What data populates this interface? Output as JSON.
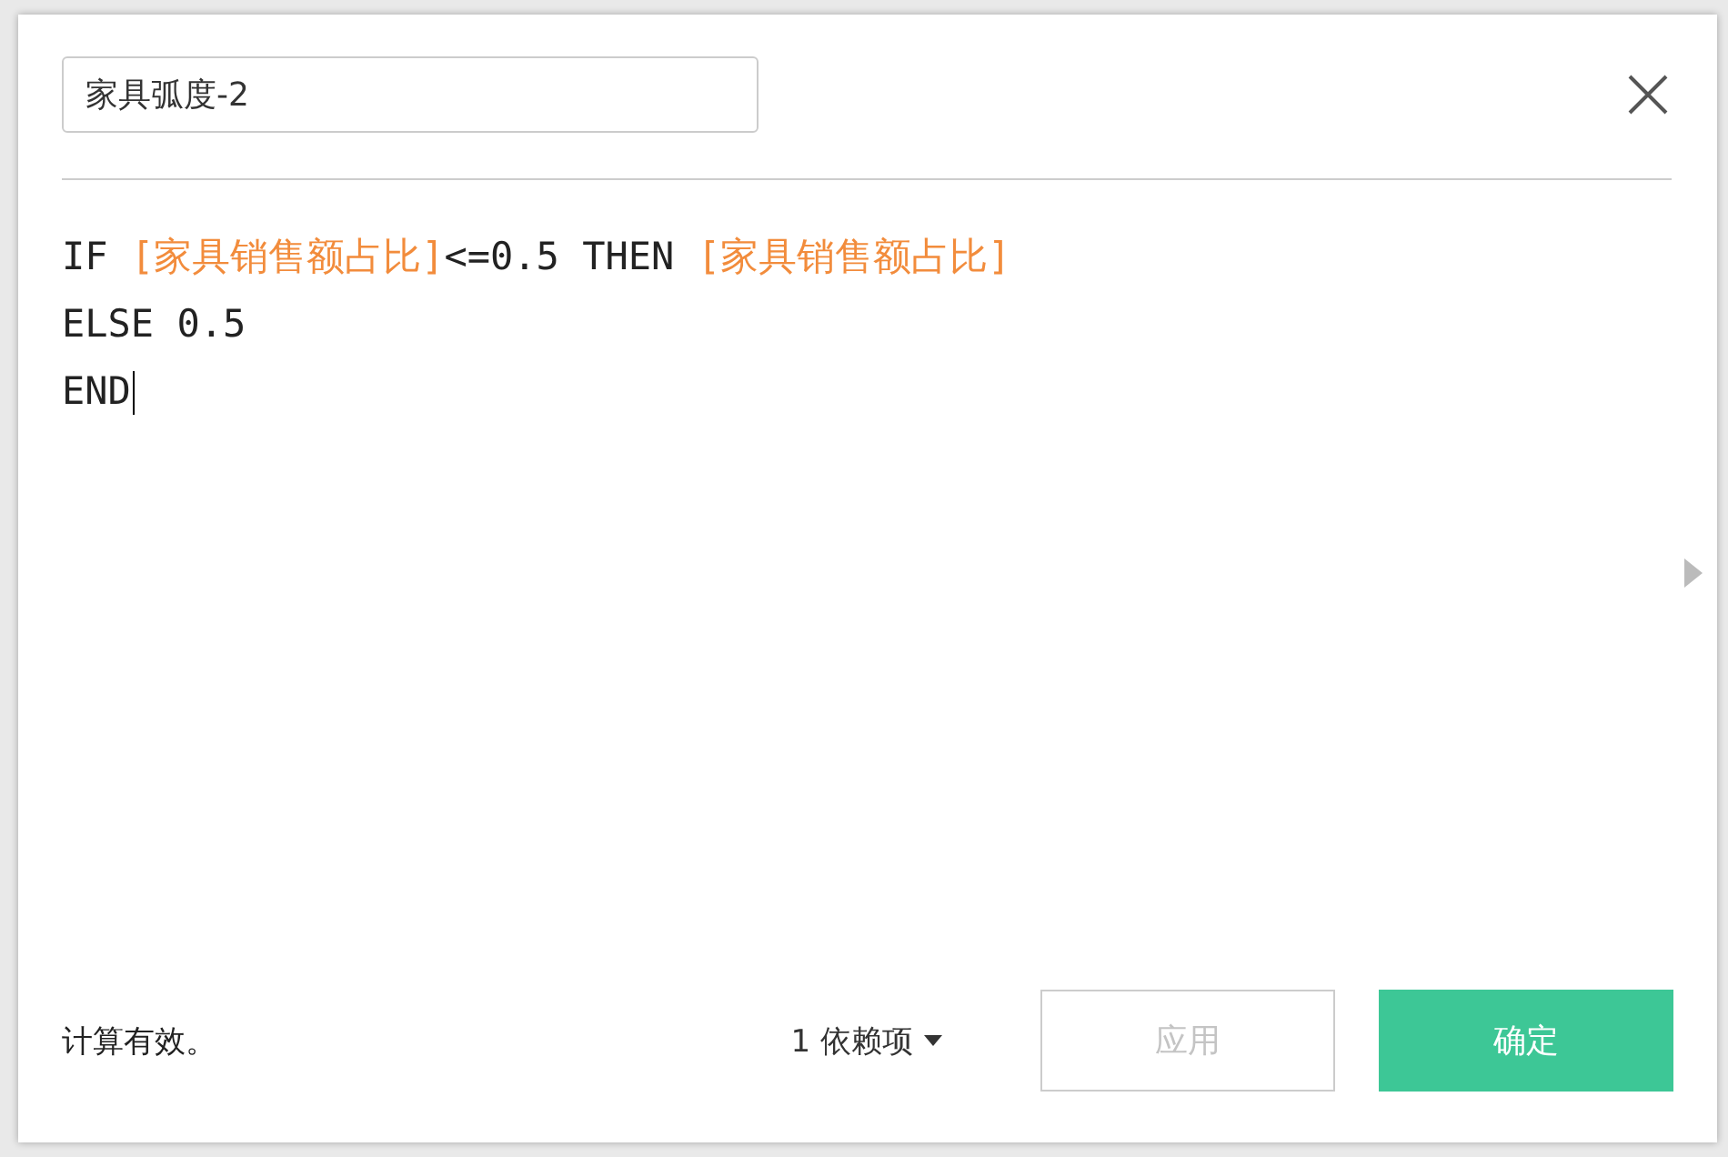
{
  "dialog": {
    "name_field": {
      "value": "家具弧度-2"
    },
    "formula_lines": [
      [
        {
          "kind": "text",
          "text": "IF "
        },
        {
          "kind": "field",
          "text": "[家具销售额占比]"
        },
        {
          "kind": "text",
          "text": "<=0.5 THEN "
        },
        {
          "kind": "field",
          "text": "[家具销售额占比]"
        }
      ],
      [
        {
          "kind": "text",
          "text": "ELSE 0.5"
        }
      ],
      [
        {
          "kind": "text",
          "text": "END"
        }
      ]
    ],
    "status": "计算有效。",
    "dependencies": "1 依赖项",
    "buttons": [
      {
        "label": "应用",
        "kind": "secondary",
        "disabled": true
      },
      {
        "label": "确定",
        "kind": "primary",
        "disabled": false
      }
    ]
  }
}
